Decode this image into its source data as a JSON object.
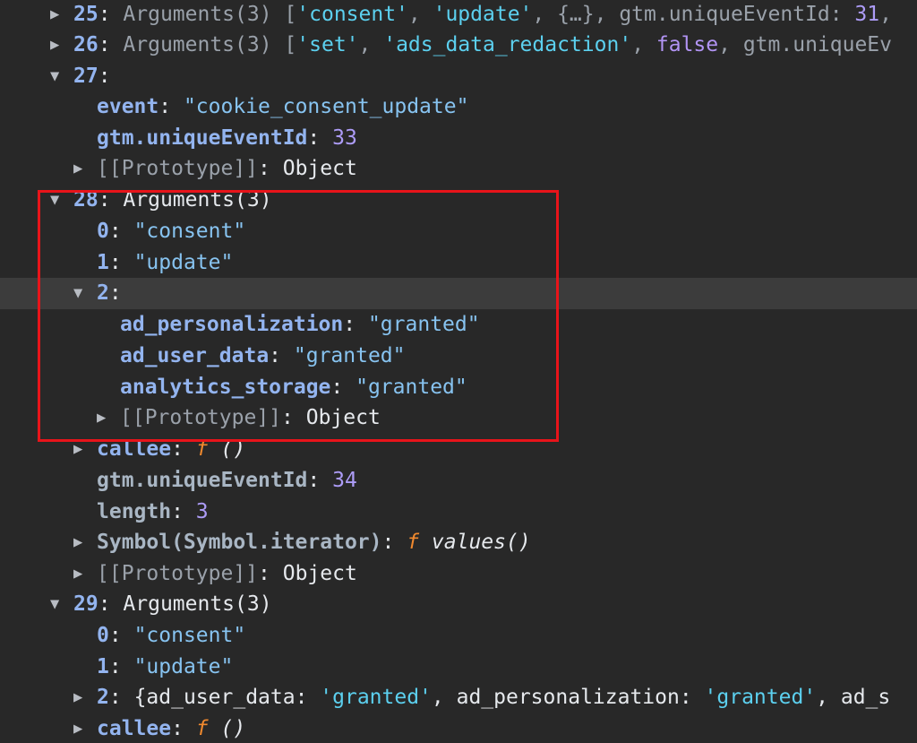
{
  "entries": {
    "e25": {
      "key": "25",
      "colon": ":",
      "summary_prefix": " Arguments(3) [",
      "a0": "'consent'",
      "sep1": ", ",
      "a1": "'update'",
      "sep2": ", {…}, gtm.uniqueEventId: ",
      "id": "31",
      "tail": ","
    },
    "e26": {
      "key": "26",
      "colon": ":",
      "summary_prefix": " Arguments(3) [",
      "a0": "'set'",
      "sep1": ", ",
      "a1": "'ads_data_redaction'",
      "sep2": ", ",
      "a2": "false",
      "tail": ", gtm.uniqueEv"
    },
    "e27": {
      "key": "27",
      "colon": ":",
      "event_key": "event",
      "event_val": "\"cookie_consent_update\"",
      "gtm_key": "gtm.uniqueEventId",
      "gtm_val": "33",
      "proto_key": "[[Prototype]]",
      "proto_val": "Object"
    },
    "e28": {
      "key": "28",
      "colon": ":",
      "summary": " Arguments(3)",
      "i0_key": "0",
      "i0_val": "\"consent\"",
      "i1_key": "1",
      "i1_val": "\"update\"",
      "i2_key": "2",
      "ad_pers_key": "ad_personalization",
      "ad_pers_val": "\"granted\"",
      "ad_user_key": "ad_user_data",
      "ad_user_val": "\"granted\"",
      "analytics_key": "analytics_storage",
      "analytics_val": "\"granted\"",
      "inner_proto_key": "[[Prototype]]",
      "inner_proto_val": "Object",
      "callee_key": "callee",
      "callee_f": "f",
      "callee_args": " ()",
      "gtm_key": "gtm.uniqueEventId",
      "gtm_val": "34",
      "length_key": "length",
      "length_val": "3",
      "symbol_key": "Symbol(Symbol.iterator)",
      "symbol_f": "f",
      "symbol_val": " values()",
      "proto_key": "[[Prototype]]",
      "proto_val": "Object"
    },
    "e29": {
      "key": "29",
      "colon": ":",
      "summary": " Arguments(3)",
      "i0_key": "0",
      "i0_val": "\"consent\"",
      "i1_key": "1",
      "i1_val": "\"update\"",
      "i2_key": "2",
      "i2_p1": " {ad_user_data: ",
      "i2_v1": "'granted'",
      "i2_p2": ", ad_personalization: ",
      "i2_v2": "'granted'",
      "i2_p3": ", ad_s",
      "callee_key": "callee",
      "callee_f": "f",
      "callee_args": " ()"
    }
  },
  "icons": {
    "expanded": "▼",
    "collapsed": "▶"
  },
  "colors": {
    "background": "#282828",
    "key": "#93b4ef",
    "string": "#87c3f0",
    "number": "#ad9cf7",
    "function": "#f0892e",
    "highlight_box": "#e8141a"
  }
}
